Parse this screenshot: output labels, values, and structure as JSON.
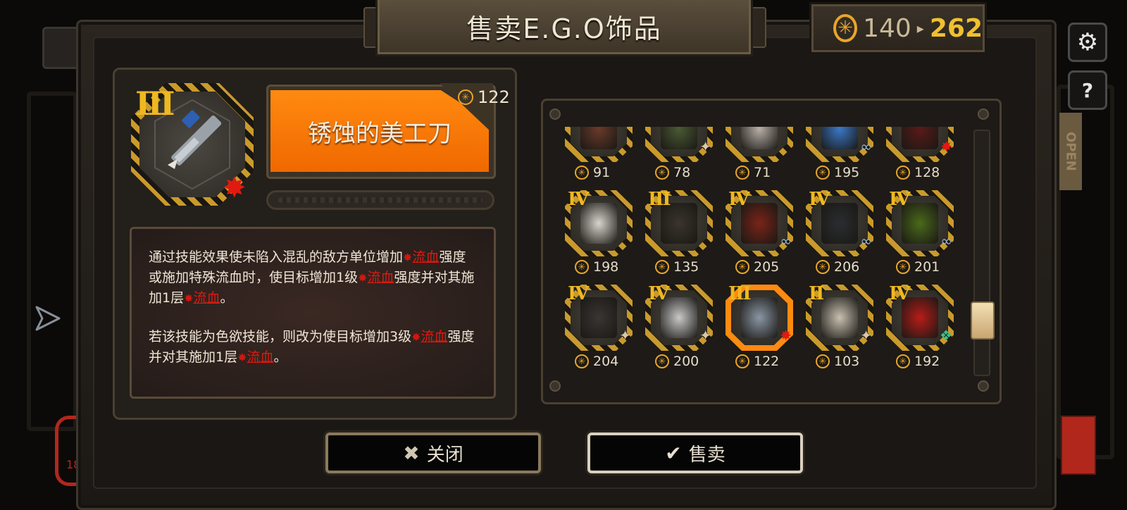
{
  "title": "售卖E.G.O饰品",
  "money": {
    "current": "140",
    "arrow": "▸",
    "after": "262"
  },
  "icons": {
    "coin": "coin-icon",
    "settings": "gear-icon",
    "help": "help-icon",
    "cursor": "pointer-arrow-icon"
  },
  "colors": {
    "accent_orange": "#f06800",
    "tier_gold": "#f0b820",
    "bleed_red": "#e01a10",
    "money_gold": "#f0c030"
  },
  "selected_item": {
    "tier": "III",
    "name": "锈蚀的美工刀",
    "price": "122",
    "description": {
      "p1_a": "通过技能效果使未陷入混乱的敌方单位增加",
      "p1_kw1": "流血",
      "p1_b": "强度或施加特殊流血时，使目标增加1级",
      "p1_kw2": "流血",
      "p1_c": "强度并对其施加1层",
      "p1_kw3": "流血",
      "p1_d": "。",
      "p2_a": "若该技能为色欲技能，则改为使目标增加3级",
      "p2_kw1": "流血",
      "p2_b": "强度并对其施加1层",
      "p2_kw2": "流血",
      "p2_c": "。"
    }
  },
  "grid": {
    "rows": [
      [
        {
          "tier": "",
          "price": "91",
          "badge": ""
        },
        {
          "tier": "",
          "price": "78",
          "badge": "✦"
        },
        {
          "tier": "",
          "price": "71",
          "badge": ""
        },
        {
          "tier": "",
          "price": "195",
          "badge": "∞"
        },
        {
          "tier": "",
          "price": "128",
          "badge": "✸"
        }
      ],
      [
        {
          "tier": "IV",
          "price": "198",
          "badge": ""
        },
        {
          "tier": "III",
          "price": "135",
          "badge": ""
        },
        {
          "tier": "IV",
          "price": "205",
          "badge": "∞"
        },
        {
          "tier": "IV",
          "price": "206",
          "badge": "∞"
        },
        {
          "tier": "IV",
          "price": "201",
          "badge": "∞"
        }
      ],
      [
        {
          "tier": "IV",
          "price": "204",
          "badge": "✦"
        },
        {
          "tier": "IV",
          "price": "200",
          "badge": "✦"
        },
        {
          "tier": "III",
          "price": "122",
          "badge": "✸"
        },
        {
          "tier": "II",
          "price": "103",
          "badge": "✦"
        },
        {
          "tier": "IV",
          "price": "192",
          "badge": "❖"
        }
      ]
    ]
  },
  "buttons": {
    "close": "关闭",
    "sell": "售卖"
  },
  "background": {
    "open_sign": "OPEN",
    "corner_number": "18"
  }
}
